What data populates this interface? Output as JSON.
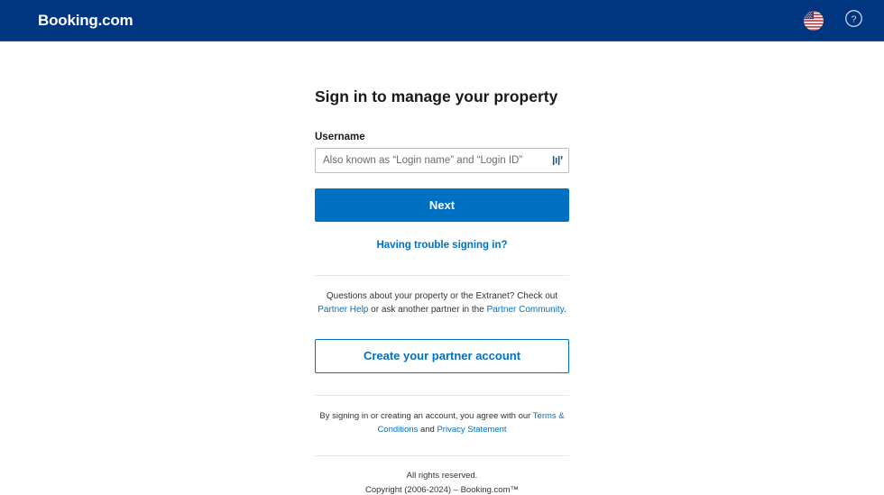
{
  "header": {
    "brand": "Booking.com",
    "brand_color": "#ffffff",
    "background_color": "#003580",
    "language_icon": "us-flag-icon",
    "help_icon": "question-mark-circle-icon"
  },
  "signin": {
    "title": "Sign in to manage your property",
    "username_label": "Username",
    "username_value": "",
    "username_placeholder": "Also known as “Login name” and “Login ID”",
    "autofill_icon": "password-manager-icon",
    "next_button": "Next",
    "trouble_link": "Having trouble signing in?",
    "primary_color": "#0071c2"
  },
  "help_section": {
    "text_part1": "Questions about your property or the Extranet? Check out ",
    "link1": "Partner Help",
    "text_part2": " or ask another partner in the ",
    "link2": "Partner Community",
    "text_part3": "."
  },
  "create_account": {
    "button_label": "Create your partner account"
  },
  "legal": {
    "text_part1": "By signing in or creating an account, you agree with our ",
    "link1": "Terms & Conditions",
    "text_part2": " and ",
    "link2": "Privacy Statement"
  },
  "footer": {
    "line1": "All rights reserved.",
    "line2": "Copyright (2006-2024) – Booking.com™"
  }
}
